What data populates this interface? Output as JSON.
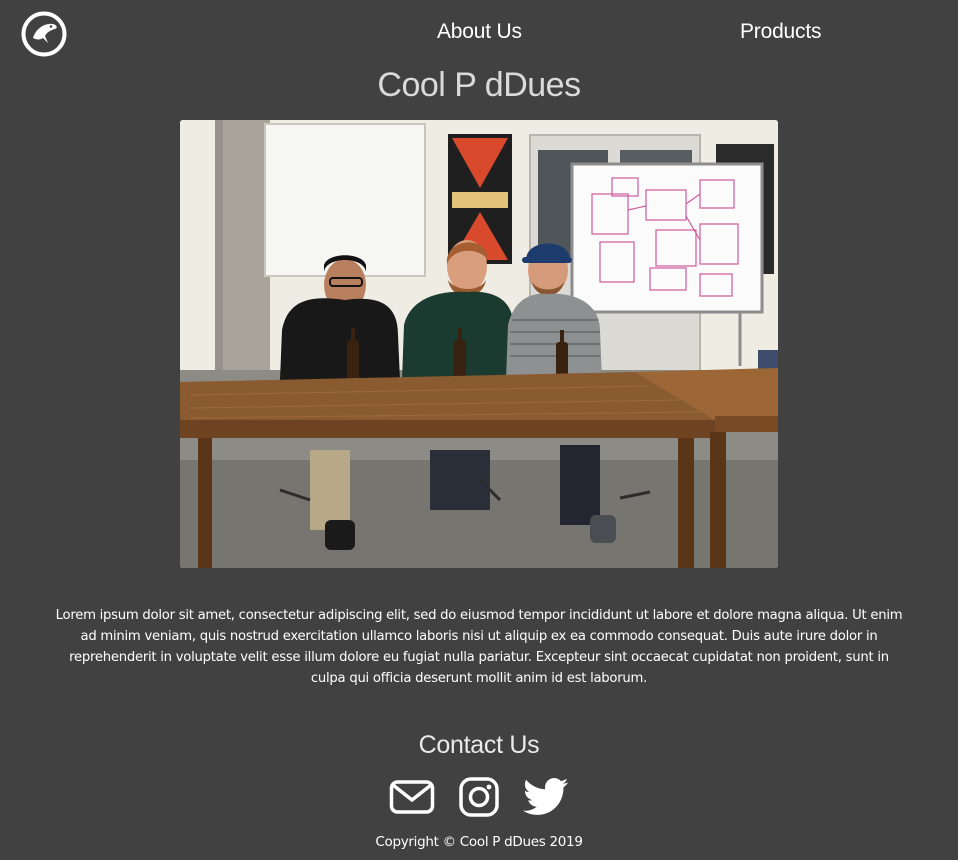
{
  "nav": {
    "logo_icon": "penguin-logo-icon",
    "about_label": "About Us",
    "products_label": "Products"
  },
  "hero": {
    "title": "Cool P dDues",
    "photo": "team-photo"
  },
  "intro": {
    "text": "Lorem ipsum dolor sit amet, consectetur adipiscing elit, sed do eiusmod tempor incididunt ut labore et dolore magna aliqua. Ut enim ad minim veniam, quis nostrud exercitation ullamco laboris nisi ut aliquip ex ea commodo consequat. Duis aute irure dolor in reprehenderit in voluptate velit esse illum dolore eu fugiat nulla pariatur. Excepteur sint occaecat cupidatat non proident, sunt in culpa qui officia deserunt mollit anim id est laborum."
  },
  "contact": {
    "heading": "Contact Us",
    "icons": [
      "mail-icon",
      "instagram-icon",
      "twitter-icon"
    ]
  },
  "footer": {
    "copyright": "Copyright © Cool P dDues 2019"
  },
  "colors": {
    "background": "#414141",
    "text": "#ffffff"
  }
}
